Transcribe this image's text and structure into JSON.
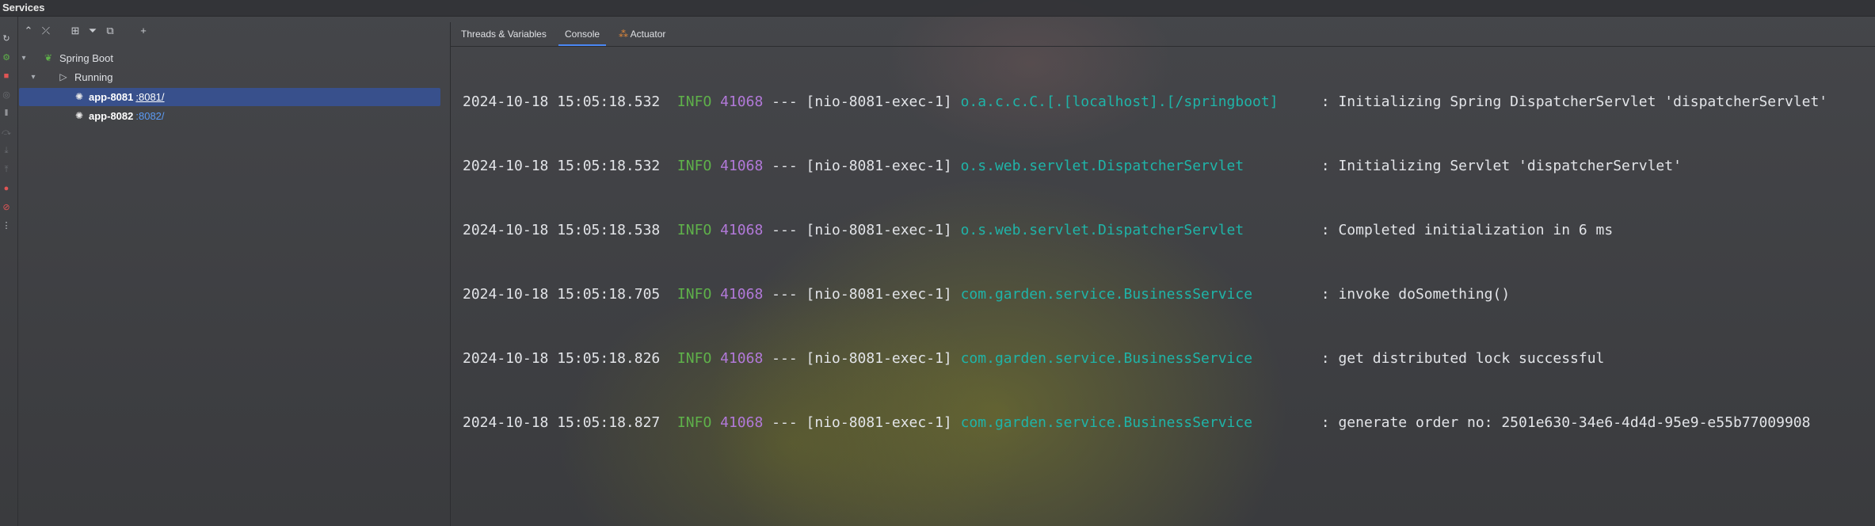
{
  "window": {
    "title": "Services"
  },
  "tree_toolbar": [
    {
      "icon": "expand-collapse-icon",
      "glyph": "⌃"
    },
    {
      "icon": "collapse-all-icon",
      "glyph": "⤫"
    },
    {
      "icon": "group-by-icon",
      "glyph": "⊞"
    },
    {
      "icon": "filter-icon",
      "glyph": "⏷"
    },
    {
      "icon": "open-new-tab-icon",
      "glyph": "⧉"
    },
    {
      "icon": "add-service-icon",
      "glyph": "+"
    }
  ],
  "tree": {
    "root": {
      "label": "Spring Boot"
    },
    "group": {
      "label": "Running"
    },
    "apps": [
      {
        "name": "app-8081",
        "port": ":8081/",
        "selected": true
      },
      {
        "name": "app-8082",
        "port": ":8082/",
        "selected": false
      }
    ]
  },
  "tabs": [
    {
      "label": "Threads & Variables",
      "active": false
    },
    {
      "label": "Console",
      "active": true
    },
    {
      "label": "Actuator",
      "active": false
    }
  ],
  "console": {
    "lines": [
      {
        "ts": "2024-10-18 15:05:18.532",
        "level": " INFO",
        "pid": "41068",
        "sep": "---",
        "thread": "[nio-8081-exec-1]",
        "logger": "o.a.c.c.C.[.[localhost].[/springboot]    ",
        "msg": ": Initializing Spring DispatcherServlet 'dispatcherServlet'"
      },
      {
        "ts": "2024-10-18 15:05:18.532",
        "level": " INFO",
        "pid": "41068",
        "sep": "---",
        "thread": "[nio-8081-exec-1]",
        "logger": "o.s.web.servlet.DispatcherServlet        ",
        "msg": ": Initializing Servlet 'dispatcherServlet'"
      },
      {
        "ts": "2024-10-18 15:05:18.538",
        "level": " INFO",
        "pid": "41068",
        "sep": "---",
        "thread": "[nio-8081-exec-1]",
        "logger": "o.s.web.servlet.DispatcherServlet        ",
        "msg": ": Completed initialization in 6 ms"
      },
      {
        "ts": "2024-10-18 15:05:18.705",
        "level": " INFO",
        "pid": "41068",
        "sep": "---",
        "thread": "[nio-8081-exec-1]",
        "logger": "com.garden.service.BusinessService       ",
        "msg": ": invoke doSomething()"
      },
      {
        "ts": "2024-10-18 15:05:18.826",
        "level": " INFO",
        "pid": "41068",
        "sep": "---",
        "thread": "[nio-8081-exec-1]",
        "logger": "com.garden.service.BusinessService       ",
        "msg": ": get distributed lock successful"
      },
      {
        "ts": "2024-10-18 15:05:18.827",
        "level": " INFO",
        "pid": "41068",
        "sep": "---",
        "thread": "[nio-8081-exec-1]",
        "logger": "com.garden.service.BusinessService       ",
        "msg": ": generate order no: 2501e630-34e6-4d4d-95e9-e55b77009908"
      }
    ]
  },
  "colors": {
    "info": "#5fb14a",
    "pid": "#b279d9",
    "logger": "#1fb4a8",
    "selection": "#38508c",
    "link": "#5b9bf5"
  }
}
